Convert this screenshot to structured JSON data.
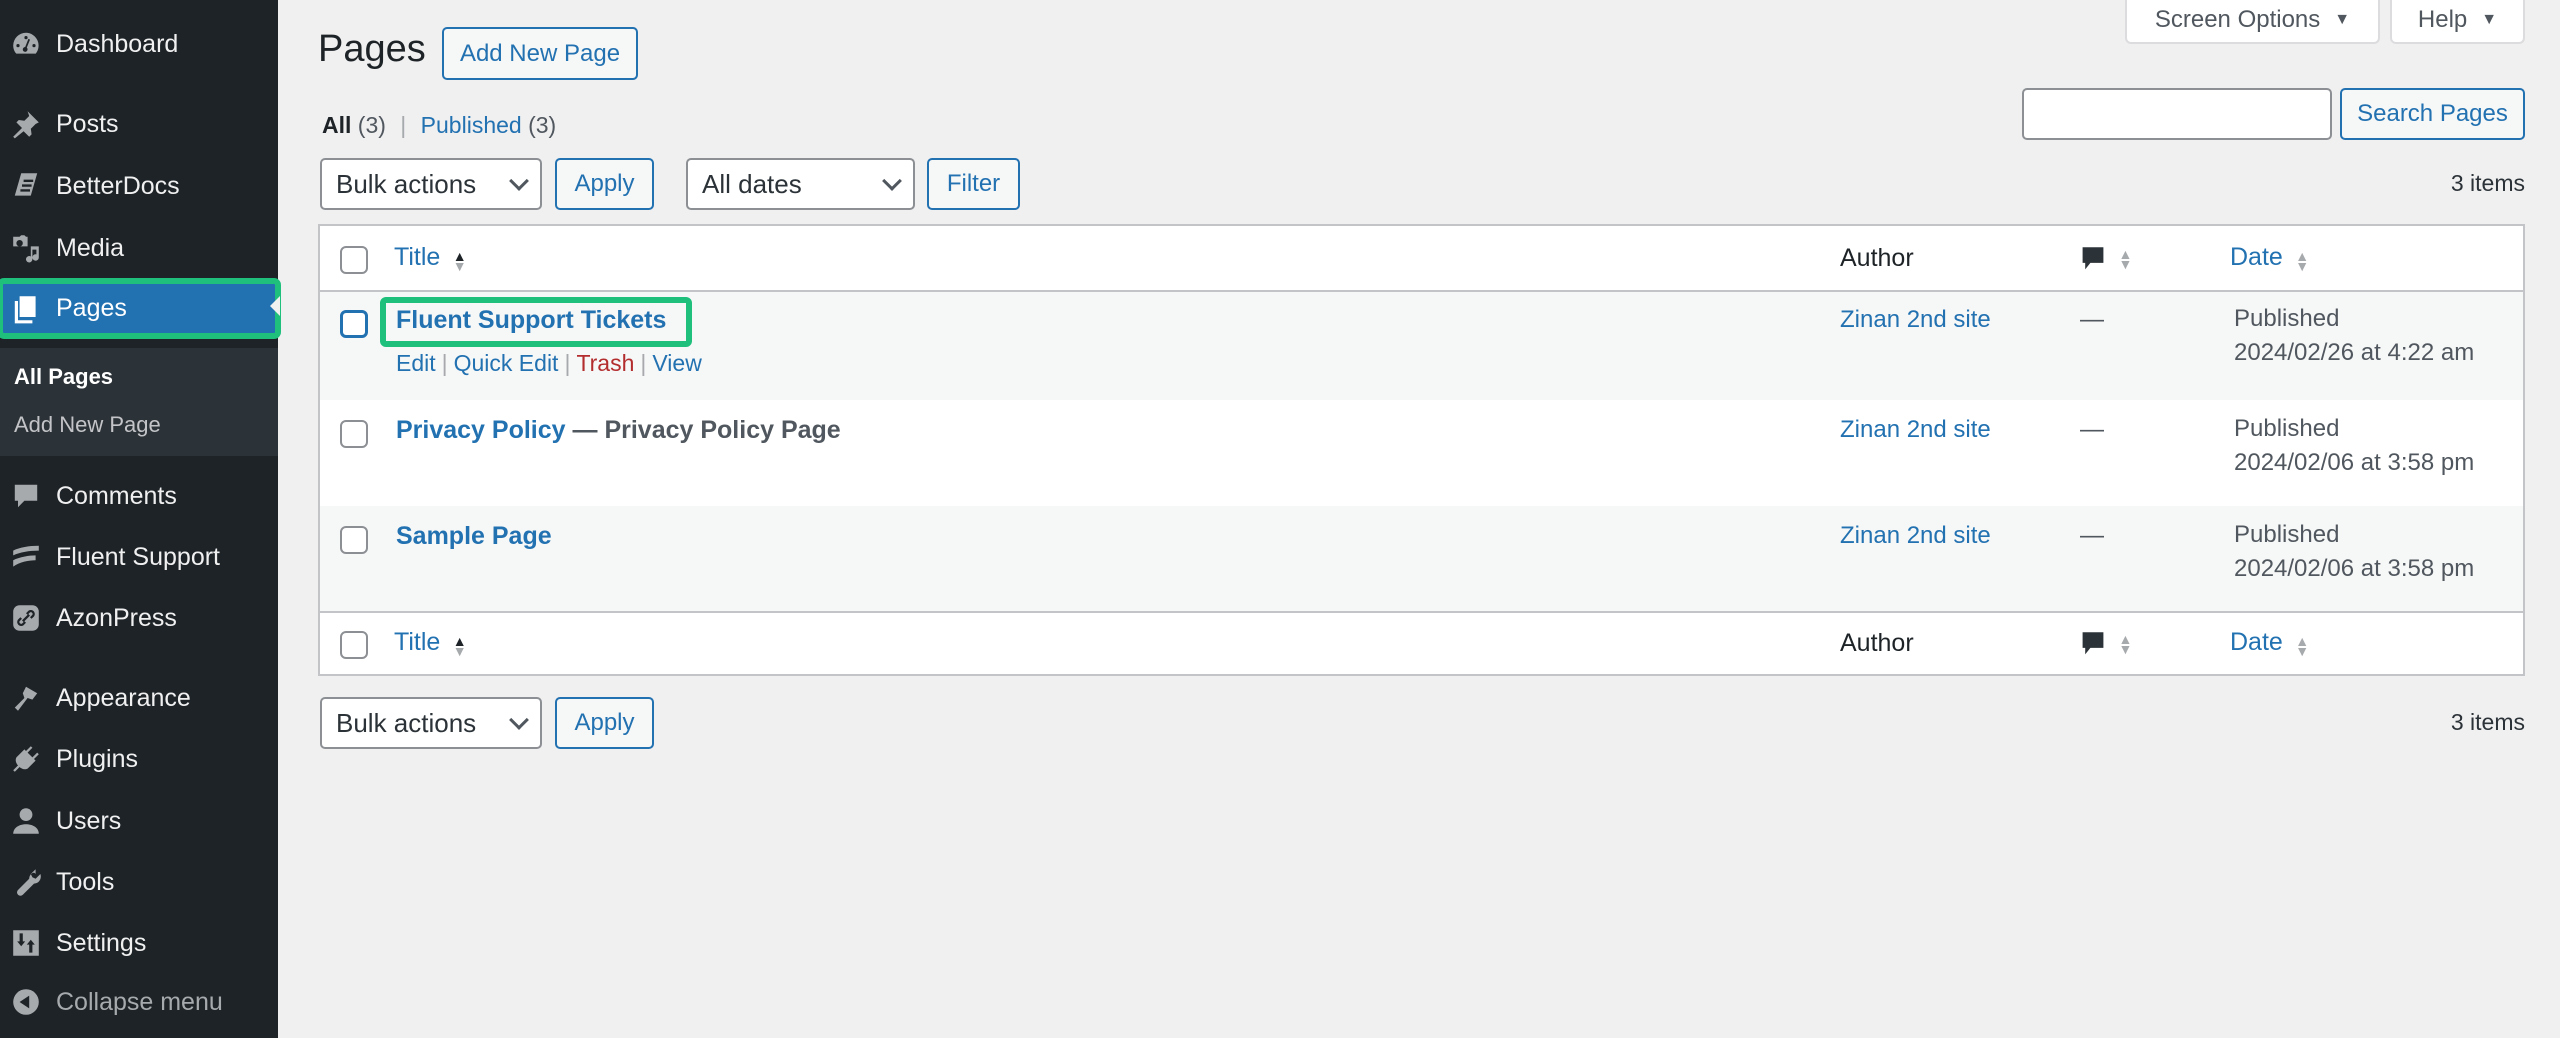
{
  "sidebar": {
    "items": [
      {
        "label": "Dashboard",
        "icon": "dashboard-icon"
      },
      {
        "label": "Posts",
        "icon": "pin-icon"
      },
      {
        "label": "BetterDocs",
        "icon": "betterdocs-icon"
      },
      {
        "label": "Media",
        "icon": "media-icon"
      },
      {
        "label": "Pages",
        "icon": "pages-icon",
        "current": true
      },
      {
        "label": "Comments",
        "icon": "comment-icon"
      },
      {
        "label": "Fluent Support",
        "icon": "fluent-support-icon"
      },
      {
        "label": "AzonPress",
        "icon": "link-icon"
      },
      {
        "label": "Appearance",
        "icon": "paintbrush-icon"
      },
      {
        "label": "Plugins",
        "icon": "plugin-icon"
      },
      {
        "label": "Users",
        "icon": "user-icon"
      },
      {
        "label": "Tools",
        "icon": "wrench-icon"
      },
      {
        "label": "Settings",
        "icon": "settings-icon"
      }
    ],
    "submenu": [
      {
        "label": "All Pages",
        "active": true
      },
      {
        "label": "Add New Page"
      }
    ],
    "collapse_label": "Collapse menu"
  },
  "header": {
    "title": "Pages",
    "add_new_label": "Add New Page",
    "screen_options_label": "Screen Options",
    "help_label": "Help"
  },
  "views": {
    "all_label": "All",
    "all_count": "(3)",
    "separator": "|",
    "published_label": "Published",
    "published_count": "(3)"
  },
  "search": {
    "value": "",
    "button_label": "Search Pages"
  },
  "toolbar_top": {
    "bulk_actions": "Bulk actions",
    "apply_label": "Apply",
    "dates": "All dates",
    "filter_label": "Filter",
    "item_count": "3 items"
  },
  "table": {
    "columns": {
      "title": "Title",
      "author": "Author",
      "comments_icon": "comment-icon",
      "date": "Date"
    },
    "rows": [
      {
        "title": "Fluent Support Tickets",
        "state": "",
        "author": "Zinan 2nd site",
        "comments": "—",
        "status": "Published",
        "date": "2024/02/26 at 4:22 am",
        "actions": [
          "Edit",
          "Quick Edit",
          "Trash",
          "View"
        ]
      },
      {
        "title": "Privacy Policy",
        "state": " — Privacy Policy Page",
        "author": "Zinan 2nd site",
        "comments": "—",
        "status": "Published",
        "date": "2024/02/06 at 3:58 pm"
      },
      {
        "title": "Sample Page",
        "state": "",
        "author": "Zinan 2nd site",
        "comments": "—",
        "status": "Published",
        "date": "2024/02/06 at 3:58 pm"
      }
    ]
  },
  "toolbar_bottom": {
    "bulk_actions": "Bulk actions",
    "apply_label": "Apply",
    "item_count": "3 items"
  },
  "colors": {
    "accent": "#2271b1",
    "sidebar_bg": "#1d2327",
    "highlight": "#1fbf7c",
    "trash": "#b32d2e"
  }
}
